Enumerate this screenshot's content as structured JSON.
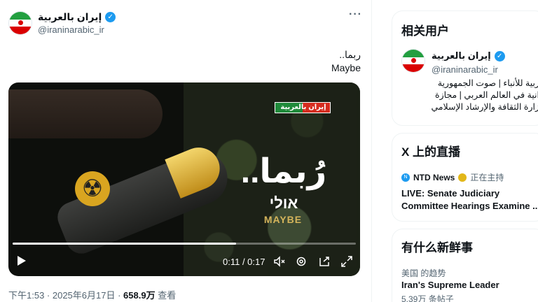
{
  "tweet": {
    "author_name": "إيران بالعربية",
    "author_handle": "@iraninarabic_ir",
    "more_label": "···",
    "text_ar": "ربما..",
    "text_en": "Maybe",
    "video": {
      "badge_text": "إيران بالعربية",
      "overlay_ar": "رُبما..",
      "overlay_he": "אולי",
      "overlay_en": "MAYBE",
      "time_display": "0:11 / 0:17",
      "progress": 0.65
    },
    "timestamp": "下午1:53 · 2025年6月17日 · ",
    "views_count": "658.9万",
    "views_label": " 查看"
  },
  "related": {
    "title": "相关用户",
    "user_name": "إيران بالعربية",
    "user_handle": "@iraninarabic_ir",
    "bio_line1": "ربية للأنباء | صوت الجمهورية",
    "bio_line2": "انية في العالم العربي | مجازة",
    "bio_line3": "زارة الثقافة والإرشاد الإسلامي"
  },
  "live": {
    "title": "X 上的直播",
    "host": "NTD News",
    "host_status": "正在主持",
    "line1": "LIVE: Senate Judiciary",
    "line2": "Committee Hearings Examine ..."
  },
  "news": {
    "title": "有什么新鲜事",
    "context": "美国 的趋势",
    "trend": "Iran's Supreme Leader",
    "count": "5.39万 条帖子"
  },
  "colors": {
    "accent": "#1d9bf0",
    "verified_gold": "#e2b719",
    "flag_green": "#239f40",
    "flag_red": "#da0000"
  }
}
